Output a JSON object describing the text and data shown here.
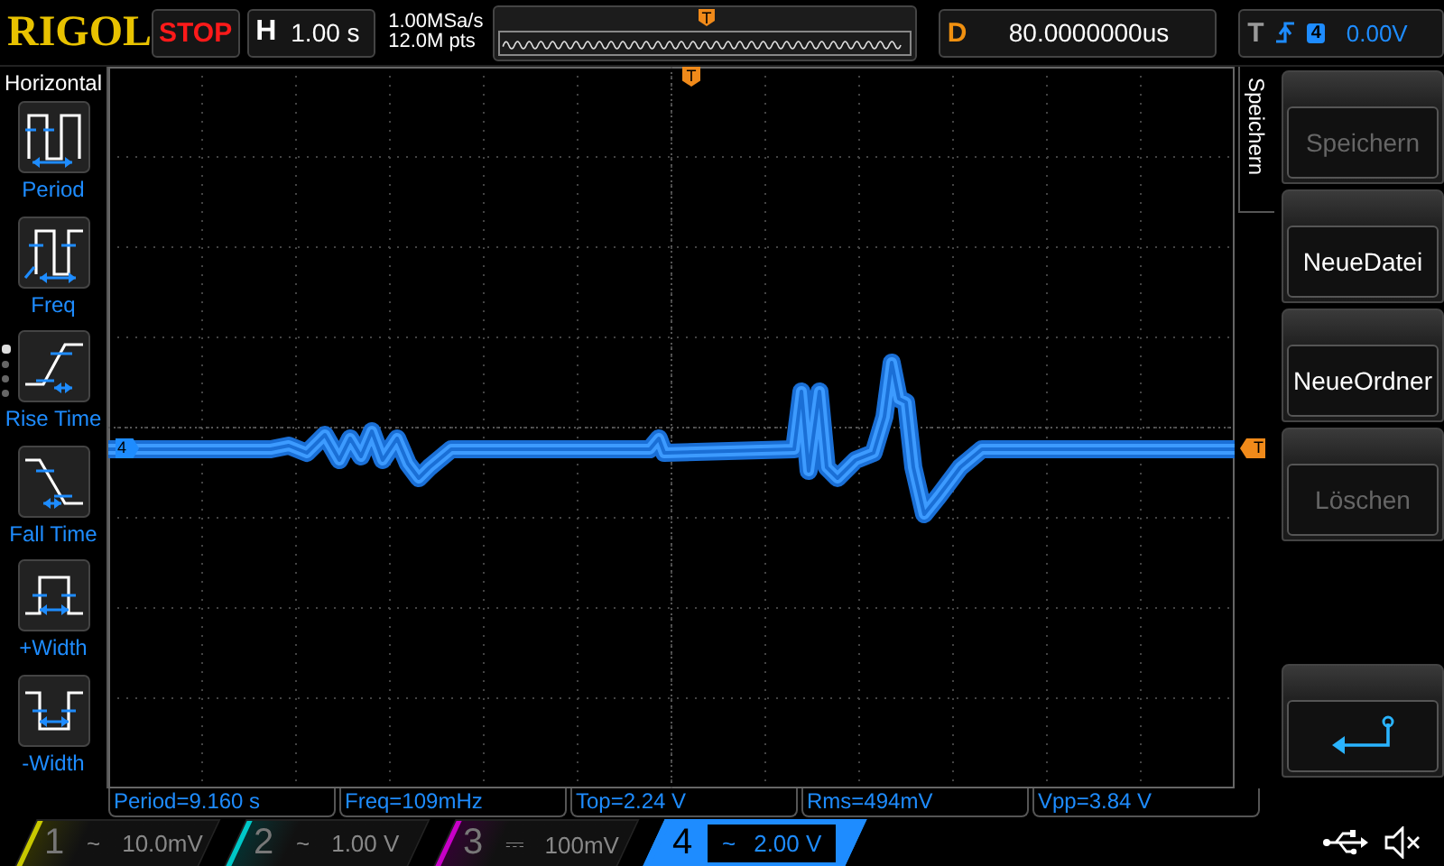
{
  "logo": "RIGOL",
  "run_state": "STOP",
  "timebase": {
    "label": "H",
    "value": "1.00 s"
  },
  "acquisition": {
    "sample_rate": "1.00MSa/s",
    "memory_depth": "12.0M pts"
  },
  "overview": {
    "trigger_marker": "T"
  },
  "delay": {
    "label": "D",
    "value": "80.0000000us"
  },
  "trigger": {
    "label": "T",
    "source": "4",
    "level": "0.00V"
  },
  "screen": {
    "trigger_marker": "T",
    "channel_marker": "4",
    "level_marker": "T"
  },
  "left_menu": {
    "title": "Horizontal",
    "pages": [
      {
        "selected": true
      },
      {
        "selected": false
      },
      {
        "selected": false
      },
      {
        "selected": false
      }
    ],
    "items": [
      {
        "kind": "period",
        "label": "Period"
      },
      {
        "kind": "freq",
        "label": "Freq"
      },
      {
        "kind": "rise",
        "label": "Rise Time"
      },
      {
        "kind": "fall",
        "label": "Fall Time"
      },
      {
        "kind": "pwidth",
        "label": "+Width"
      },
      {
        "kind": "nwidth",
        "label": "-Width"
      }
    ]
  },
  "right_menu": {
    "title": "Speichern",
    "items": [
      {
        "kind": "text",
        "label": "Speichern",
        "disabled": true
      },
      {
        "kind": "text",
        "label": "NeueDatei",
        "disabled": false
      },
      {
        "kind": "text",
        "label": "NeueOrdner",
        "disabled": false
      },
      {
        "kind": "text",
        "label": "Löschen",
        "disabled": true
      },
      {
        "kind": "back"
      }
    ]
  },
  "measurements": [
    "Period=9.160 s",
    "Freq=109mHz",
    "Top=2.24 V",
    "Rms=494mV",
    "Vpp=3.84 V"
  ],
  "channels": [
    {
      "number": "1",
      "coupling": "~",
      "scale": "10.0mV",
      "color": "#c8c800",
      "active": false
    },
    {
      "number": "2",
      "coupling": "~",
      "scale": "1.00 V",
      "color": "#00c8c8",
      "active": false
    },
    {
      "number": "3",
      "coupling": "⎓",
      "scale": "100mV",
      "color": "#c800c8",
      "active": false
    },
    {
      "number": "4",
      "coupling": "~",
      "scale": "2.00 V",
      "color": "#1e8cff",
      "active": true
    }
  ]
}
